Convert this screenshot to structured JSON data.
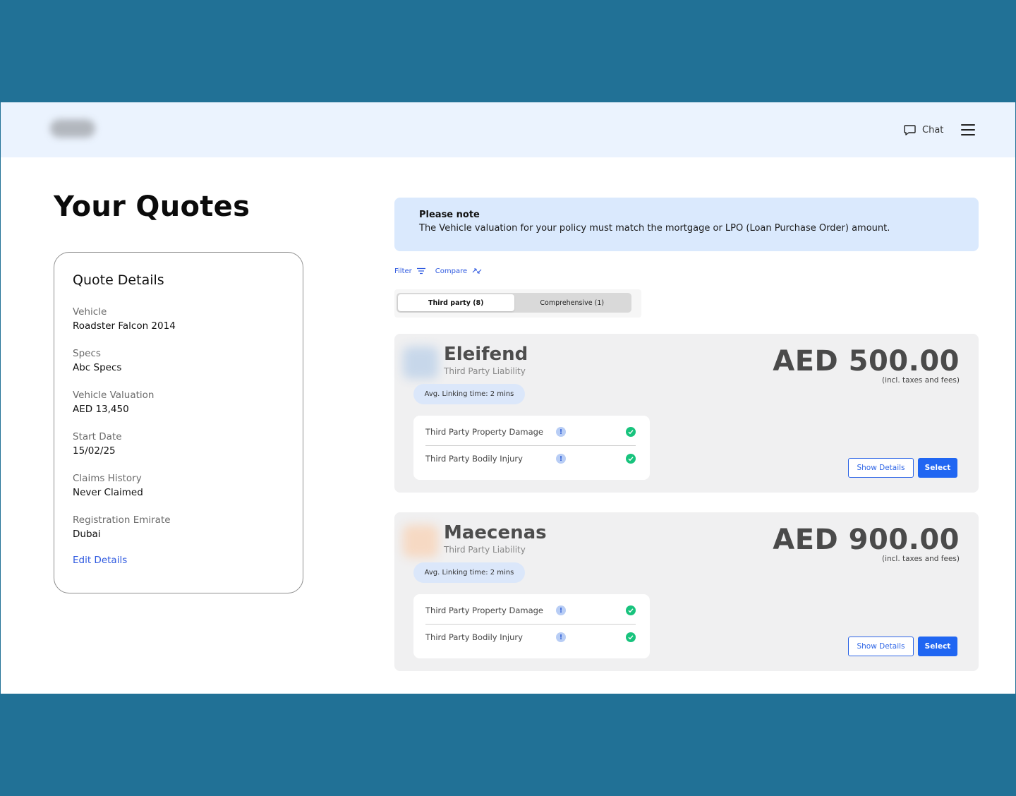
{
  "header": {
    "chat_label": "Chat",
    "chat_icon": "chat-bubble-icon",
    "menu_icon": "hamburger-menu-icon"
  },
  "page": {
    "title": "Your Quotes"
  },
  "quote_details": {
    "title": "Quote Details",
    "fields": [
      {
        "label": "Vehicle",
        "value": "Roadster Falcon 2014"
      },
      {
        "label": "Specs",
        "value": "Abc Specs"
      },
      {
        "label": "Vehicle Valuation",
        "value": "AED 13,450"
      },
      {
        "label": "Start Date",
        "value": "15/02/25"
      },
      {
        "label": "Claims History",
        "value": "Never Claimed"
      },
      {
        "label": "Registration Emirate",
        "value": "Dubai"
      }
    ],
    "edit_label": "Edit Details"
  },
  "note": {
    "title": "Please note",
    "text": "The Vehicle valuation for your policy must match the mortgage or LPO (Loan Purchase Order) amount."
  },
  "tools": {
    "filter_label": "Filter",
    "compare_label": "Compare"
  },
  "tabs": [
    {
      "label": "Third party (8)",
      "active": true
    },
    {
      "label": "Comprehensive (1)",
      "active": false
    }
  ],
  "quotes": [
    {
      "insurer": "Eleifend",
      "plan": "Third Party Liability",
      "linking_time": "Avg. Linking time: 2 mins",
      "price": "AED 500.00",
      "price_note": "(incl. taxes and fees)",
      "logo_color": "#c7d7ea",
      "covers": [
        "Third Party Property Damage",
        "Third Party Bodily Injury"
      ],
      "show_details_label": "Show Details",
      "select_label": "Select"
    },
    {
      "insurer": "Maecenas",
      "plan": "Third Party Liability",
      "linking_time": "Avg. Linking time: 2 mins",
      "price": "AED 900.00",
      "price_note": "(incl. taxes and fees)",
      "logo_color": "#f6d9c3",
      "covers": [
        "Third Party Property Damage",
        "Third Party Bodily Injury"
      ],
      "show_details_label": "Show Details",
      "select_label": "Select"
    }
  ],
  "colors": {
    "frame_background": "#217196",
    "header_background": "#ebf3fe",
    "accent": "#2066f2",
    "note_background": "#dae9fd",
    "check": "#18c37d"
  }
}
